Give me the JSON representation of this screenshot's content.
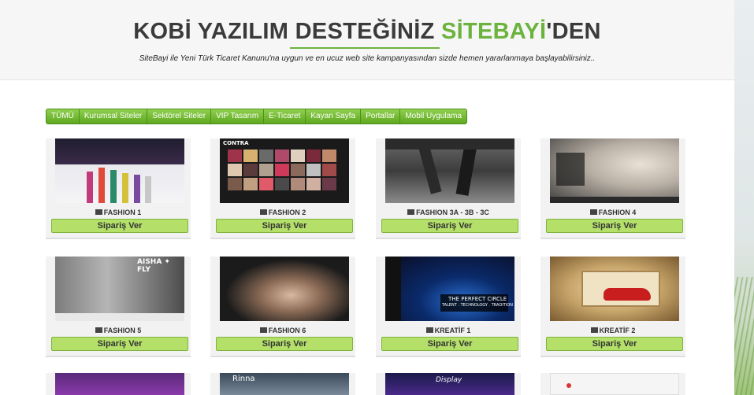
{
  "header": {
    "title_part1": "KOBİ YAZILIM DESTEĞİNİZ ",
    "title_accent": "SİTEBAYİ",
    "title_part2": "'DEN",
    "subtitle": "SiteBayi ile Yeni Türk Ticaret Kanunu'na uygun ve en ucuz web site kampanyasından sizde hemen yararlanmaya başlayabilirsiniz.."
  },
  "tabs": [
    "TÜMÜ",
    "Kurumsal Siteler",
    "Sektörel Siteler",
    "VIP Tasarım",
    "E-Ticaret",
    "Kayan Sayfa",
    "Portallar",
    "Mobil Uygulama"
  ],
  "cards": [
    {
      "title": "FASHION 1",
      "button": "Sipariş Ver"
    },
    {
      "title": "FASHION 2",
      "button": "Sipariş Ver"
    },
    {
      "title": "FASHION 3A - 3B - 3C",
      "button": "Sipariş Ver"
    },
    {
      "title": "FASHION 4",
      "button": "Sipariş Ver"
    },
    {
      "title": "FASHION 5",
      "button": "Sipariş Ver"
    },
    {
      "title": "FASHION 6",
      "button": "Sipariş Ver"
    },
    {
      "title": "KREATİF 1",
      "button": "Sipariş Ver"
    },
    {
      "title": "KREATİF 2",
      "button": "Sipariş Ver"
    }
  ],
  "thumb_text": {
    "fashion2_logo": "CONTRA",
    "fashion5_logo": "AISHA ✦ FLY",
    "kreatif1_line1": "THE PERFECT CIRCLE",
    "kreatif1_line2": "TALENT . TECHNOLOGY . TRADITION",
    "row3_c2": "Rinna",
    "row3_c3": "Display"
  },
  "colors": {
    "accent": "#6cb33e",
    "button": "#b4e06a",
    "tab_bar": "#6cb33e"
  }
}
